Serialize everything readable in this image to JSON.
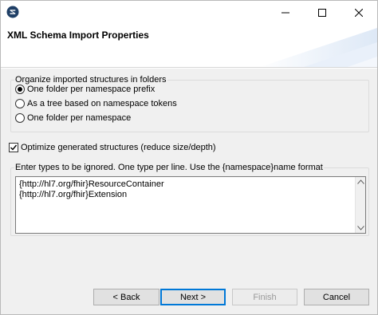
{
  "window": {
    "title": ""
  },
  "header": {
    "title": "XML Schema Import Properties"
  },
  "organize": {
    "legend": "Organize imported structures in folders",
    "options": [
      {
        "label": "One folder per namespace prefix",
        "selected": true
      },
      {
        "label": "As a tree based on namespace tokens",
        "selected": false
      },
      {
        "label": "One folder per namespace",
        "selected": false
      }
    ]
  },
  "optimize": {
    "label": "Optimize generated structures (reduce size/depth)",
    "checked": true
  },
  "ignored_types": {
    "legend": "Enter types to be ignored. One type per line. Use the {namespace}name format",
    "lines": [
      "{http://hl7.org/fhir}ResourceContainer",
      "{http://hl7.org/fhir}Extension"
    ]
  },
  "buttons": {
    "back": "< Back",
    "next": "Next >",
    "finish": "Finish",
    "cancel": "Cancel"
  },
  "colors": {
    "accent": "#0078d7",
    "dialog_bg": "#f0f0f0"
  }
}
